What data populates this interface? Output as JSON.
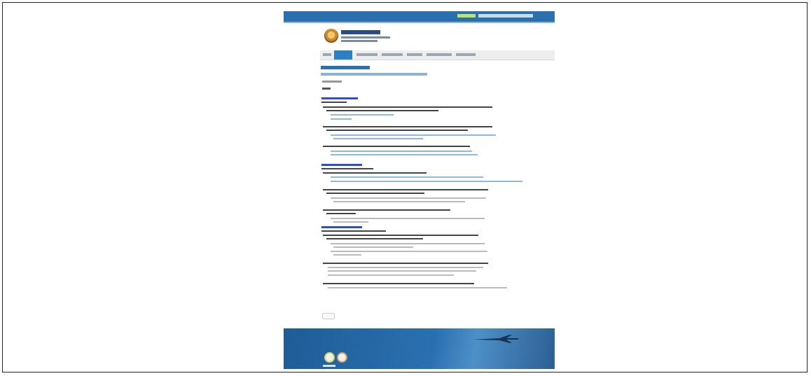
{
  "colors": {
    "header_blue": "#2a6fae",
    "nav_active": "#2a7fc6",
    "section_link": "#2a4fd0",
    "footer_blue": "#1f5c97"
  },
  "topbar": {
    "link_primary": "",
    "link_secondary": ""
  },
  "brand": {
    "title": "",
    "subtitle_1": "",
    "subtitle_2": ""
  },
  "nav": {
    "items": [
      {
        "label": ""
      },
      {
        "label": "",
        "active": true
      },
      {
        "label": ""
      },
      {
        "label": ""
      },
      {
        "label": ""
      },
      {
        "label": ""
      },
      {
        "label": ""
      }
    ]
  },
  "article": {
    "title": "",
    "subtitle": "",
    "meta_date": "",
    "meta_views": "",
    "back_button": ""
  },
  "icons": [
    "logo-seal-icon",
    "airplane-icon",
    "footer-badge-icon"
  ]
}
